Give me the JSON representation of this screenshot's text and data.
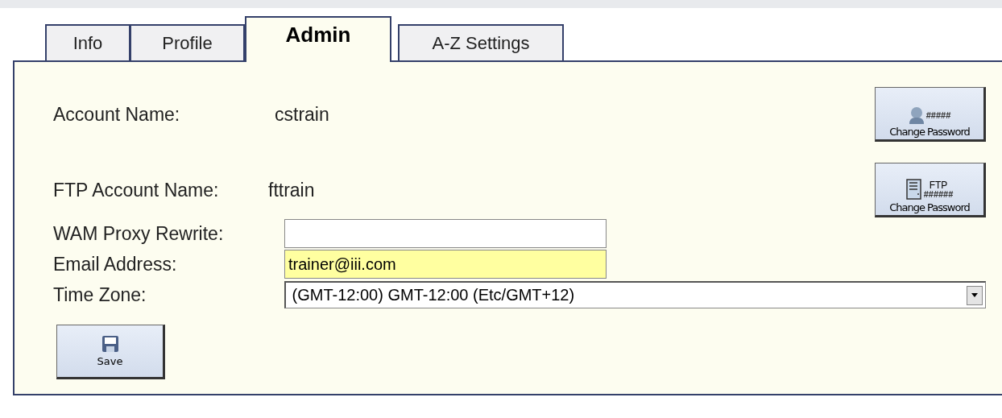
{
  "tabs": [
    {
      "label": "Info",
      "selected": false
    },
    {
      "label": "Profile",
      "selected": false
    },
    {
      "label": "Admin",
      "selected": true
    },
    {
      "label": "A-Z Settings",
      "selected": false
    }
  ],
  "account": {
    "label": "Account Name:",
    "value": "cstrain",
    "button": {
      "mark": "#####",
      "label": "Change Password"
    }
  },
  "ftp": {
    "label": "FTP Account Name:",
    "value": "fttrain",
    "button": {
      "title": "FTP",
      "mark": "######",
      "label": "Change Password"
    }
  },
  "fields": [
    {
      "kind": "input",
      "label": "WAM Proxy Rewrite:",
      "highlighted": false
    },
    {
      "kind": "input",
      "label": "Email Address:",
      "value": "trainer@iii.com",
      "highlighted": true
    },
    {
      "kind": "select",
      "label": "Time Zone:",
      "value": "(GMT-12:00) GMT-12:00 (Etc/GMT+12)"
    }
  ],
  "save_button": {
    "label": "Save"
  }
}
